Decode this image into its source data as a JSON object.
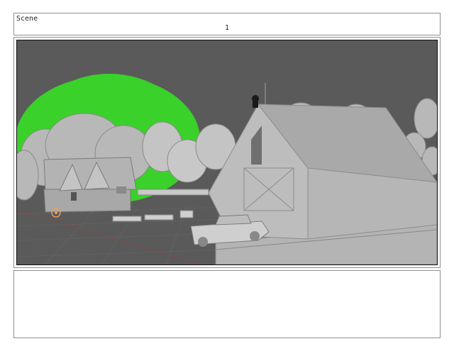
{
  "header": {
    "scene_label": "Scene",
    "shot_number": "1"
  },
  "viewport": {
    "background_color": "#5a5a5a",
    "accent_color": "#39d12a",
    "objects": [
      "green-sun",
      "tree-cluster",
      "small-house",
      "barn",
      "weather-vane",
      "pickup-truck",
      "fence",
      "origin-marker",
      "grid-floor"
    ]
  },
  "notes": {
    "text": ""
  }
}
